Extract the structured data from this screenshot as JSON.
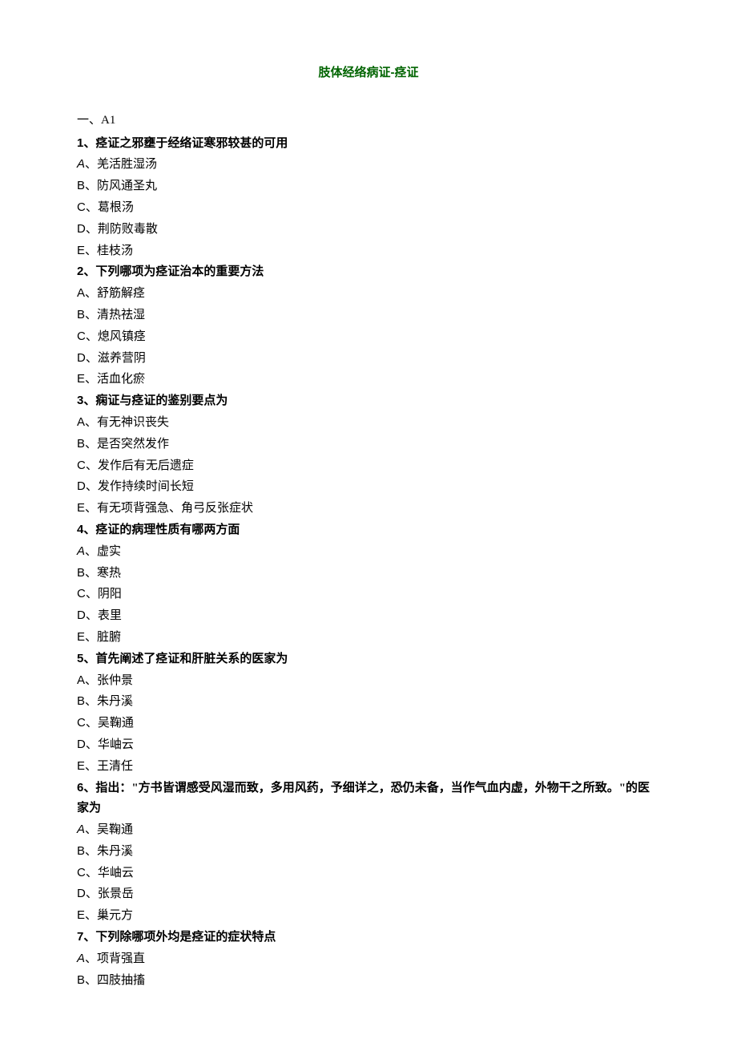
{
  "title": "肢体经络病证-痉证",
  "section_label": "一、A1",
  "questions": [
    {
      "num": "1",
      "stem": "痉证之邪壅于经络证寒邪较甚的可用",
      "options": [
        {
          "m": "A",
          "sep": "、",
          "t": "羌活胜湿汤",
          "italic_marker": true
        },
        {
          "m": "B",
          "sep": "、",
          "t": "防风通圣丸"
        },
        {
          "m": "C",
          "sep": "、",
          "t": "葛根汤"
        },
        {
          "m": "D",
          "sep": "、",
          "t": "荆防败毒散"
        },
        {
          "m": "E",
          "sep": "、",
          "t": "桂枝汤"
        }
      ]
    },
    {
      "num": "2",
      "stem": "下列哪项为痉证治本的重要方法",
      "options": [
        {
          "m": "A",
          "sep": "、",
          "t": "舒筋解痉"
        },
        {
          "m": "B",
          "sep": "、",
          "t": "清热祛湿"
        },
        {
          "m": "C",
          "sep": "、",
          "t": "熄风镇痉"
        },
        {
          "m": "D",
          "sep": "、",
          "t": "滋养营阴"
        },
        {
          "m": "E",
          "sep": "、",
          "t": "活血化瘀"
        }
      ]
    },
    {
      "num": "3",
      "stem": "痫证与痉证的鉴别要点为",
      "options": [
        {
          "m": "A",
          "sep": "、",
          "t": "有无神识丧失"
        },
        {
          "m": "B",
          "sep": "、",
          "t": "是否突然发作"
        },
        {
          "m": "C",
          "sep": "、",
          "t": "发作后有无后遗症"
        },
        {
          "m": "D",
          "sep": "、",
          "t": "发作持续时间长短"
        },
        {
          "m": "E",
          "sep": "、",
          "t": "有无项背强急、角弓反张症状"
        }
      ]
    },
    {
      "num": "4",
      "stem": "痉证的病理性质有哪两方面",
      "options": [
        {
          "m": "A",
          "sep": "、",
          "t": "虚实",
          "italic_marker": true
        },
        {
          "m": "B",
          "sep": "、",
          "t": "寒热"
        },
        {
          "m": "C",
          "sep": "、",
          "t": "阴阳"
        },
        {
          "m": "D",
          "sep": "、",
          "t": "表里"
        },
        {
          "m": "E",
          "sep": "、",
          "t": "脏腑"
        }
      ]
    },
    {
      "num": "5",
      "stem": "首先阐述了痉证和肝脏关系的医家为",
      "options": [
        {
          "m": "A",
          "sep": "、",
          "t": "张仲景"
        },
        {
          "m": "B",
          "sep": "、",
          "t": "朱丹溪"
        },
        {
          "m": "C",
          "sep": "、",
          "t": "吴鞠通"
        },
        {
          "m": "D",
          "sep": "、",
          "t": "华岫云"
        },
        {
          "m": "E",
          "sep": "、",
          "t": "王清任"
        }
      ]
    },
    {
      "num": "6",
      "stem": "指出：\"方书皆谓感受风湿而致，多用风药，予细详之，恐仍未备，当作气血内虚，外物干之所致。\"的医家为",
      "options": [
        {
          "m": "A",
          "sep": "、",
          "t": "吴鞠通",
          "italic_marker": true
        },
        {
          "m": "B",
          "sep": "、",
          "t": "朱丹溪"
        },
        {
          "m": "C",
          "sep": "、",
          "t": "华岫云"
        },
        {
          "m": "D",
          "sep": "、",
          "t": "张景岳"
        },
        {
          "m": "E",
          "sep": "、",
          "t": "巢元方"
        }
      ]
    },
    {
      "num": "7",
      "stem": "下列除哪项外均是痉证的症状特点",
      "options": [
        {
          "m": "A",
          "sep": "、",
          "t": "项背强直",
          "italic_marker": true
        },
        {
          "m": "B",
          "sep": "、",
          "t": "四肢抽搐"
        }
      ]
    }
  ]
}
